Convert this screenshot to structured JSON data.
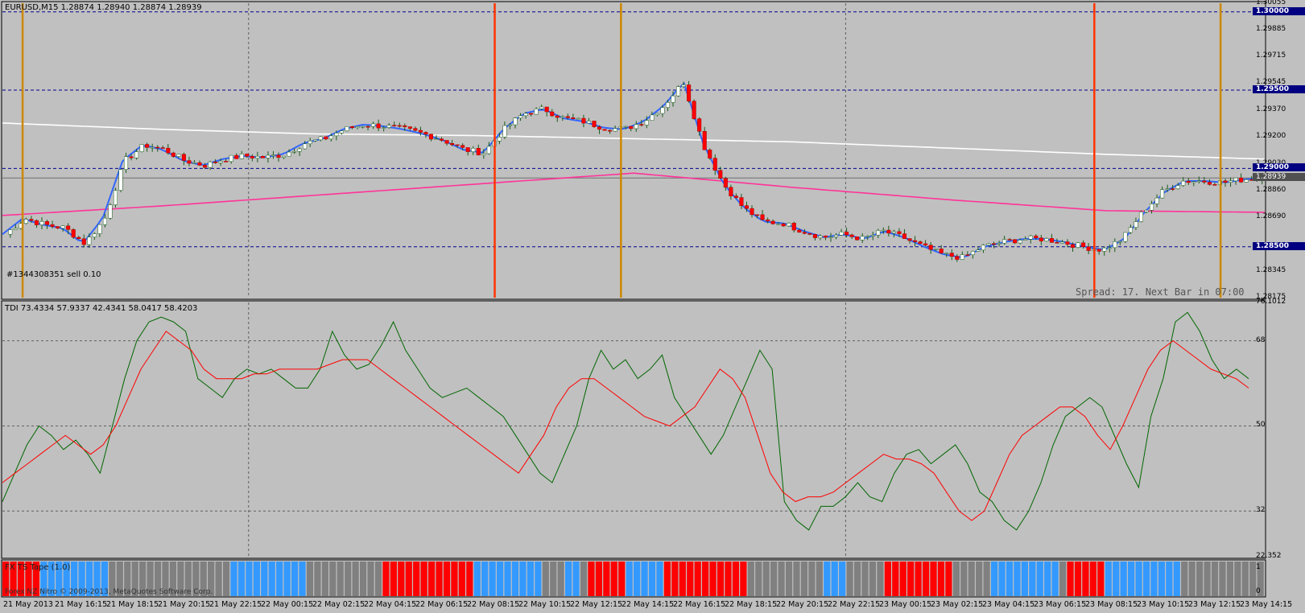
{
  "main_panel": {
    "header": "EURUSD,M15  1.28874 1.28940 1.28874 1.28939",
    "order_label": "#1344308351 sell 0.10",
    "spread_text": "Spread: 17. Next Bar in 07:00",
    "price_labels": [
      "1.30055",
      "1.30000",
      "1.29885",
      "1.29715",
      "1.29545",
      "1.29500",
      "1.29370",
      "1.29200",
      "1.29030",
      "1.29000",
      "1.28939",
      "1.28860",
      "1.28690",
      "1.28500",
      "1.28345",
      "1.28175"
    ],
    "highlight_prices": [
      "1.30000",
      "1.29500",
      "1.29000",
      "1.28500"
    ],
    "current_price": "1.28939",
    "y_range": [
      1.28175,
      1.30055
    ],
    "horizontal_levels": [
      1.3,
      1.295,
      1.29,
      1.285
    ]
  },
  "tdi_panel": {
    "header": "TDI 73.4334 57.9337 42.4341 58.0417 58.4203",
    "scale_labels": [
      "76.1012",
      "68",
      "50",
      "32",
      "22.352"
    ],
    "y_range": [
      22.352,
      76.1012
    ],
    "levels": [
      68,
      50,
      32
    ]
  },
  "bar_panel": {
    "header": "FX TS Tape (1.0)",
    "watermark": "Forex NZ Nitro © 2009-2013, MetaQuotes Software Corp.",
    "scale_labels": [
      "1",
      "0"
    ],
    "colors": [
      "#ff0000",
      "#3399ff",
      "#808080"
    ]
  },
  "time_labels": [
    "21 May 2013",
    "21 May 16:15",
    "21 May 18:15",
    "21 May 20:15",
    "21 May 22:15",
    "22 May 00:15",
    "22 May 02:15",
    "22 May 04:15",
    "22 May 06:15",
    "22 May 08:15",
    "22 May 10:15",
    "22 May 12:15",
    "22 May 14:15",
    "22 May 16:15",
    "22 May 18:15",
    "22 May 20:15",
    "22 May 22:15",
    "23 May 00:15",
    "23 May 02:15",
    "23 May 04:15",
    "23 May 06:15",
    "23 May 08:15",
    "23 May 10:15",
    "23 May 12:15",
    "23 May 14:15"
  ],
  "chart_data": {
    "type": "candlestick",
    "symbol": "EURUSD",
    "timeframe": "M15",
    "price_path": [
      1.2858,
      1.2868,
      1.2864,
      1.2862,
      1.2852,
      1.2868,
      1.2905,
      1.2915,
      1.2912,
      1.2905,
      1.2902,
      1.2906,
      1.2908,
      1.2907,
      1.2909,
      1.2916,
      1.2919,
      1.2925,
      1.2928,
      1.2927,
      1.2925,
      1.2922,
      1.2918,
      1.2912,
      1.291,
      1.2925,
      1.2935,
      1.2938,
      1.2932,
      1.293,
      1.2926,
      1.2925,
      1.293,
      1.294,
      1.2955,
      1.2915,
      1.289,
      1.2875,
      1.2866,
      1.2865,
      1.286,
      1.2856,
      1.2858,
      1.2855,
      1.286,
      1.2856,
      1.285,
      1.2845,
      1.2843,
      1.285,
      1.2853,
      1.2855,
      1.2855,
      1.2853,
      1.285,
      1.2848,
      1.2855,
      1.2872,
      1.2885,
      1.2892,
      1.2892,
      1.2891,
      1.2893,
      1.2894
    ],
    "moving_averages": [
      {
        "color": "#ffffff",
        "values": [
          1.2929,
          1.2925,
          1.2922,
          1.2921,
          1.2919,
          1.2917,
          1.2913,
          1.2909,
          1.2906
        ]
      },
      {
        "color": "#ff3399",
        "values": [
          1.287,
          1.2876,
          1.2883,
          1.289,
          1.2897,
          1.2888,
          1.288,
          1.2873,
          1.2872
        ]
      },
      {
        "color": "#3366ff",
        "values": [
          1.2858,
          1.2868,
          1.2864,
          1.2862,
          1.2852,
          1.2868,
          1.2905,
          1.2915,
          1.2912,
          1.2905,
          1.2902,
          1.2906,
          1.2908,
          1.2907,
          1.2909,
          1.2916,
          1.2919,
          1.2925,
          1.2928,
          1.2927,
          1.2925,
          1.2922,
          1.2918,
          1.2912,
          1.291,
          1.2925,
          1.2935,
          1.2938,
          1.2932,
          1.293,
          1.2926,
          1.2925,
          1.293,
          1.294,
          1.2955,
          1.2915,
          1.289,
          1.2875,
          1.2866,
          1.2865,
          1.286,
          1.2856,
          1.2858,
          1.2855,
          1.286,
          1.2856,
          1.285,
          1.2845,
          1.2843,
          1.285,
          1.2853,
          1.2855,
          1.2855,
          1.2853,
          1.285,
          1.2848,
          1.2855,
          1.2872,
          1.2885,
          1.2892,
          1.2892,
          1.2891,
          1.2893,
          1.2894
        ]
      }
    ],
    "tdi_green": [
      34,
      40,
      46,
      50,
      48,
      45,
      47,
      44,
      40,
      50,
      60,
      68,
      72,
      73,
      72,
      70,
      60,
      58,
      56,
      60,
      62,
      61,
      62,
      60,
      58,
      58,
      62,
      70,
      65,
      62,
      63,
      67,
      72,
      66,
      62,
      58,
      56,
      57,
      58,
      56,
      54,
      52,
      48,
      44,
      40,
      38,
      44,
      50,
      60,
      66,
      62,
      64,
      60,
      62,
      65,
      56,
      52,
      48,
      44,
      48,
      54,
      60,
      66,
      62,
      34,
      30,
      28,
      33,
      33,
      35,
      38,
      35,
      34,
      40,
      44,
      45,
      42,
      44,
      46,
      42,
      36,
      34,
      30,
      28,
      32,
      38,
      46,
      52,
      54,
      56,
      54,
      48,
      42,
      37,
      52,
      60,
      72,
      74,
      70,
      64,
      60,
      62,
      60
    ],
    "tdi_red": [
      38,
      40,
      42,
      44,
      46,
      48,
      46,
      44,
      46,
      50,
      56,
      62,
      66,
      70,
      68,
      66,
      62,
      60,
      60,
      60,
      61,
      61,
      62,
      62,
      62,
      62,
      63,
      64,
      64,
      64,
      62,
      60,
      58,
      56,
      54,
      52,
      50,
      48,
      46,
      44,
      42,
      40,
      44,
      48,
      54,
      58,
      60,
      60,
      58,
      56,
      54,
      52,
      51,
      50,
      52,
      54,
      58,
      62,
      60,
      56,
      48,
      40,
      36,
      34,
      35,
      35,
      36,
      38,
      40,
      42,
      44,
      43,
      43,
      42,
      40,
      36,
      32,
      30,
      32,
      38,
      44,
      48,
      50,
      52,
      54,
      54,
      52,
      48,
      45,
      50,
      56,
      62,
      66,
      68,
      66,
      64,
      62,
      61,
      60,
      58
    ],
    "markers": {
      "orange_red": [
        0.39,
        0.865
      ],
      "goldenrod": [
        0.016,
        0.49,
        0.965
      ]
    }
  }
}
